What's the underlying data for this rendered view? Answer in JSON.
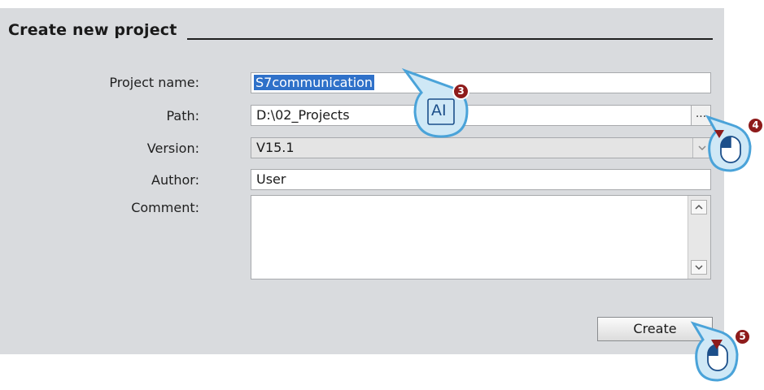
{
  "dialog": {
    "title": "Create new project"
  },
  "form": {
    "project_name": {
      "label": "Project name:",
      "value": "S7communication"
    },
    "path": {
      "label": "Path:",
      "value": "D:\\02_Projects",
      "browse_label": "..."
    },
    "version": {
      "label": "Version:",
      "value": "V15.1"
    },
    "author": {
      "label": "Author:",
      "value": "User"
    },
    "comment": {
      "label": "Comment:",
      "value": ""
    }
  },
  "actions": {
    "create_label": "Create"
  },
  "annotations": {
    "step_typing": {
      "number": "3",
      "glyph": "AI"
    },
    "step_browse": {
      "number": "4"
    },
    "step_create": {
      "number": "5"
    },
    "badge_color": "#8e1b1b",
    "callout_color": "#4aa3d9",
    "callout_fill": "#cfe8f6"
  },
  "colors": {
    "selection": "#2f71c9",
    "dialog_background": "#d9dbde"
  }
}
